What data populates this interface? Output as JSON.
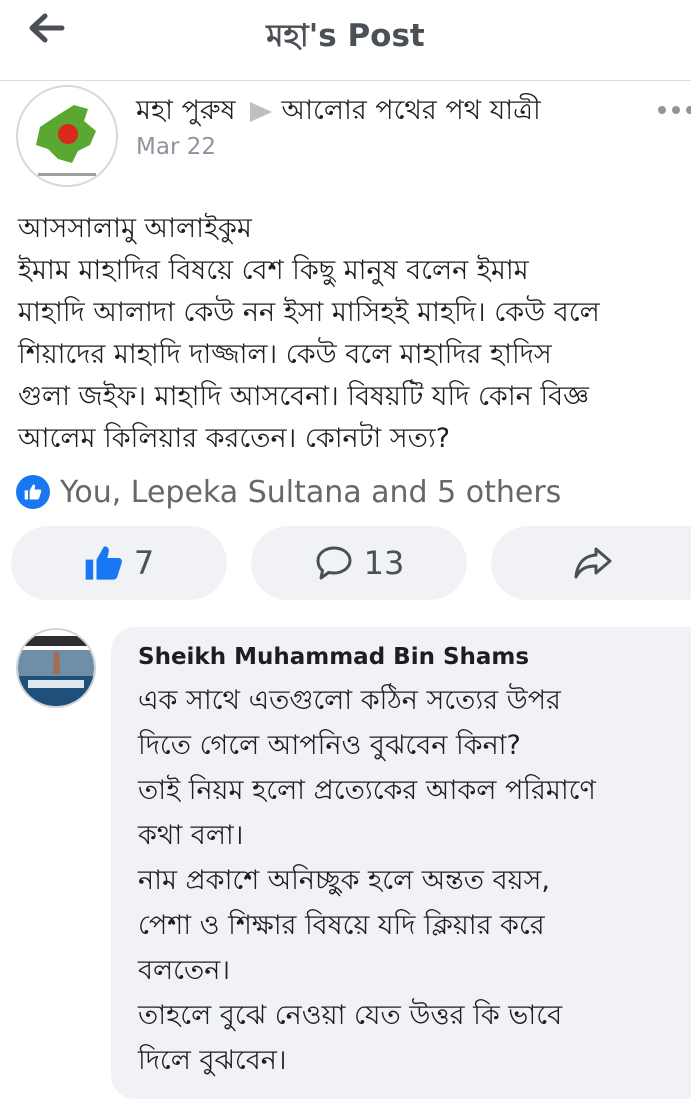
{
  "header": {
    "title": "মহা's Post",
    "back_icon": "arrow-left-icon"
  },
  "post": {
    "author": "মহা পুরুষ",
    "group": "আলোর পথের পথ যাত্রী",
    "date": "Mar 22",
    "lines": [
      "আসসালামু আলাইকুম",
      "ইমাম মাহাদির বিষয়ে বেশ কিছু মানুষ বলেন ইমাম",
      "মাহাদি আলাদা কেউ নন ইসা মাসিহই মাহদি। কেউ বলে",
      "শিয়াদের মাহাদি দাজ্জাল। কেউ বলে মাহাদির হাদিস",
      "গুলা জইফ। মাহাদি আসবেনা। বিষয়টি যদি কোন বিজ্ঞ",
      "আলেম কিলিয়ার করতেন। কোনটা সত্য?"
    ]
  },
  "reactions": {
    "summary": "You, Lepeka Sultana and 5 others"
  },
  "actions": {
    "like_count": "7",
    "comment_count": "13"
  },
  "comment": {
    "author": "Sheikh Muhammad Bin Shams",
    "lines": [
      "এক সাথে এতগুলো কঠিন সত্যের উপর",
      "দিতে গেলে আপনিও বুঝবেন কিনা?",
      "তাই নিয়ম হলো প্রত্যেকের আকল পরিমাণে",
      "কথা বলা।",
      "নাম প্রকাশে অনিচ্ছুক হলে অন্তত বয়স,",
      "পেশা ও শিক্ষার বিষয়ে যদি ক্লিয়ার করে",
      "বলতেন।",
      "তাহলে বুঝে নেওয়া যেত উত্তর কি ভাবে",
      "দিলে বুঝবেন।"
    ]
  },
  "colors": {
    "accent": "#1877f2",
    "bubble": "#f0f2f5",
    "meta": "#8d949e"
  }
}
